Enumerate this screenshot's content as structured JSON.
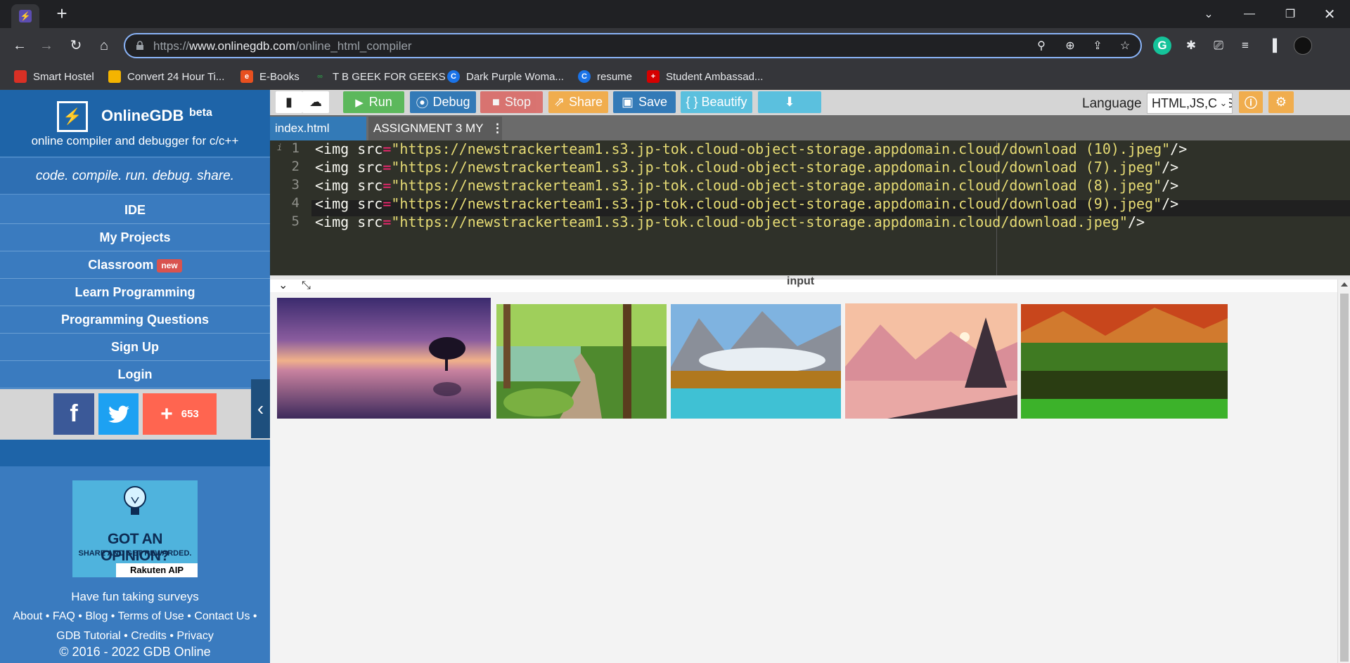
{
  "browser": {
    "url_scheme": "https://",
    "url_host": "www.onlinegdb.com",
    "url_path": "/online_html_compiler",
    "bookmarks": [
      {
        "label": "Smart Hostel",
        "icon": "hostel-icon",
        "color": "#d93025"
      },
      {
        "label": "Convert 24 Hour Ti...",
        "icon": "calendar-icon",
        "color": "#f4b400"
      },
      {
        "label": "E-Books",
        "icon": "ebooks-icon",
        "color": "#e8501f"
      },
      {
        "label": "T B GEEK FOR  GEEKS",
        "icon": "geeksforgeeks-icon",
        "color": "#2f8d46"
      },
      {
        "label": "Dark Purple Woma...",
        "icon": "canva-icon",
        "color": "#1a73e8"
      },
      {
        "label": "resume",
        "icon": "canva-icon",
        "color": "#1a73e8"
      },
      {
        "label": "Student Ambassad...",
        "icon": "student-icon",
        "color": "#d50000"
      }
    ]
  },
  "sidebar": {
    "brand_name": "OnlineGDB",
    "brand_beta": "beta",
    "brand_sub": "online compiler and debugger for c/c++",
    "tagline": "code. compile. run. debug. share.",
    "menu": [
      {
        "label": "IDE"
      },
      {
        "label": "My Projects"
      },
      {
        "label": "Classroom",
        "badge": "new"
      },
      {
        "label": "Learn Programming"
      },
      {
        "label": "Programming Questions"
      },
      {
        "label": "Sign Up"
      },
      {
        "label": "Login"
      }
    ],
    "share_count": "653",
    "ad": {
      "title": "GOT AN OPINION?",
      "subtitle": "SHARE AND GET REWARDED.",
      "brand": "Rakuten AIP"
    },
    "fun_text": "Have fun taking surveys",
    "footer_links": [
      "About",
      "FAQ",
      "Blog",
      "Terms of Use",
      "Contact Us",
      "GDB Tutorial",
      "Credits",
      "Privacy"
    ],
    "copyright": "© 2016 - 2022 GDB Online"
  },
  "toolbar": {
    "run": "Run",
    "debug": "Debug",
    "stop": "Stop",
    "share": "Share",
    "save": "Save",
    "beautify": "{ } Beautify",
    "language_label": "Language",
    "language_value": "HTML,JS,CSS",
    "colors": {
      "run": "#5cb85c",
      "debug": "#337ab7",
      "stop": "#d9534f",
      "share": "#f0ad4e",
      "save": "#337ab7",
      "beautify": "#5bc0de",
      "download": "#5bc0de"
    }
  },
  "tabs": [
    {
      "label": "index.html"
    },
    {
      "label": "ASSIGNMENT 3 MY"
    }
  ],
  "code": {
    "lines": [
      {
        "num": "1",
        "tag": "<img",
        "attr": " src",
        "eq": "=",
        "value": "\"https://newstrackerteam1.s3.jp-tok.cloud-object-storage.appdomain.cloud/download (10).jpeg\"",
        "end": "/>"
      },
      {
        "num": "2",
        "tag": "<img",
        "attr": " src",
        "eq": "=",
        "value": "\"https://newstrackerteam1.s3.jp-tok.cloud-object-storage.appdomain.cloud/download (7).jpeg\"",
        "end": "/>"
      },
      {
        "num": "3",
        "tag": "<img",
        "attr": " src",
        "eq": "=",
        "value": "\"https://newstrackerteam1.s3.jp-tok.cloud-object-storage.appdomain.cloud/download (8).jpeg\"",
        "end": "/>"
      },
      {
        "num": "4",
        "tag": "<img",
        "attr": " src",
        "eq": "=",
        "value": "\"https://newstrackerteam1.s3.jp-tok.cloud-object-storage.appdomain.cloud/download (9).jpeg\"",
        "end": "/>"
      },
      {
        "num": "5",
        "tag": "<img",
        "attr": " src",
        "eq": "=",
        "value": "\"https://newstrackerteam1.s3.jp-tok.cloud-object-storage.appdomain.cloud/download.jpeg\"",
        "end": "/>"
      }
    ]
  },
  "output": {
    "input_label": "input"
  }
}
